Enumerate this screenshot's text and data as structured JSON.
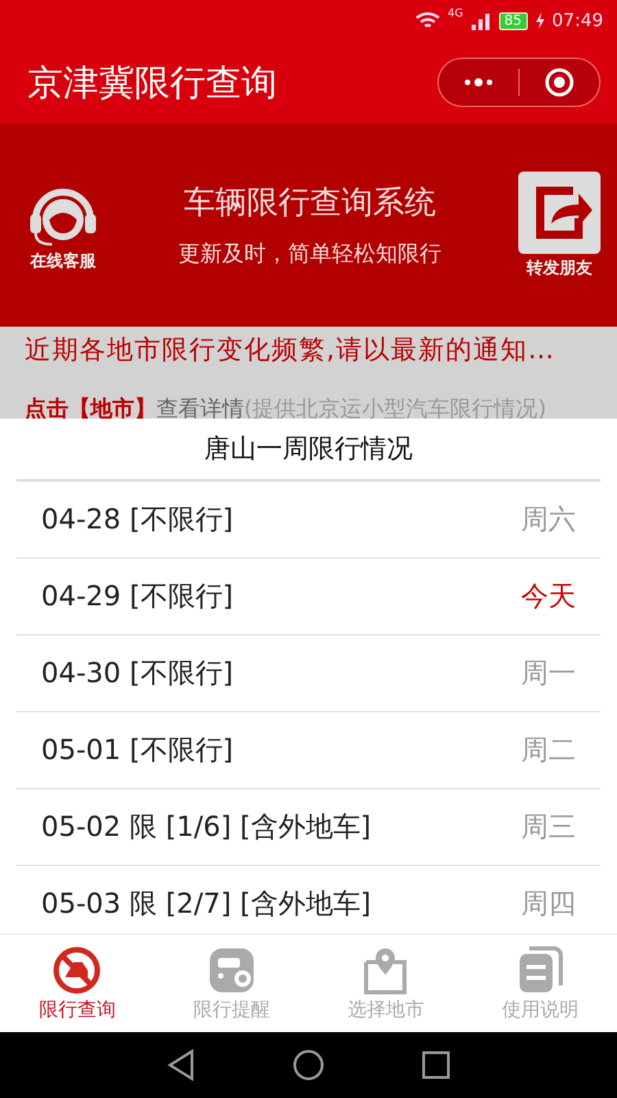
{
  "status_bar": {
    "network": "4G",
    "battery": "85",
    "time": "07:49"
  },
  "app_bar": {
    "title": "京津冀限行查询"
  },
  "banner": {
    "left_label": "在线客服",
    "title": "车辆限行查询系统",
    "subtitle": "更新及时，简单轻松知限行",
    "right_label": "转发朋友"
  },
  "notice": "近期各地市限行变化频繁,请以最新的通知…",
  "hint": {
    "link": "点击【地市】",
    "action": "查看详情",
    "note": "(提供北京运小型汽车限行情况)"
  },
  "sheet": {
    "title": "唐山一周限行情况",
    "rows": [
      {
        "date": "04-28 [不限行]",
        "day": "周六",
        "today": false
      },
      {
        "date": "04-29 [不限行]",
        "day": "今天",
        "today": true
      },
      {
        "date": "04-30 [不限行]",
        "day": "周一",
        "today": false
      },
      {
        "date": "05-01 [不限行]",
        "day": "周二",
        "today": false
      },
      {
        "date": "05-02 限 [1/6] [含外地车]",
        "day": "周三",
        "today": false
      },
      {
        "date": "05-03 限 [2/7] [含外地车]",
        "day": "周四",
        "today": false
      }
    ]
  },
  "tabs": [
    {
      "label": "限行查询",
      "kind": "query",
      "selected": true
    },
    {
      "label": "限行提醒",
      "kind": "remind",
      "selected": false
    },
    {
      "label": "选择地市",
      "kind": "city",
      "selected": false
    },
    {
      "label": "使用说明",
      "kind": "help",
      "selected": false
    }
  ]
}
